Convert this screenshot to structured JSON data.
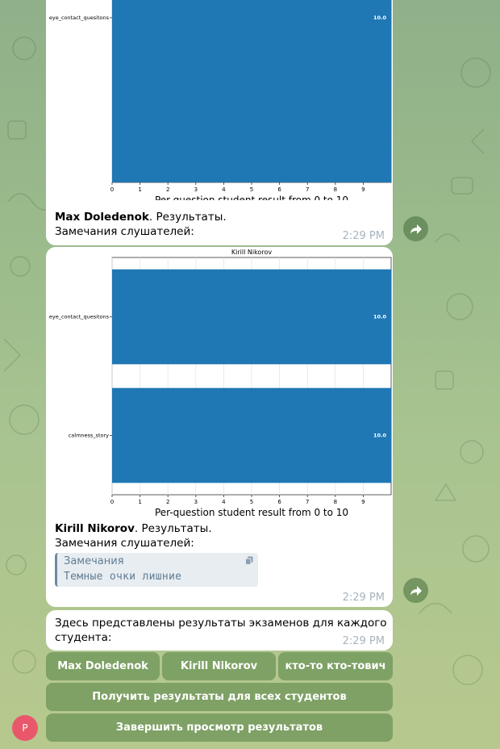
{
  "theme": {
    "accent": "#1f77b4",
    "time_color": "#a7b4be",
    "button_bg": "#70965a"
  },
  "messages": [
    {
      "chart_title": "",
      "caption_name": "Max Doledenok",
      "caption_rest": ". Результаты.",
      "remarks_label": "Замечания слушателей:",
      "time": "2:29 PM"
    },
    {
      "chart_title": "Kirill Nikorov",
      "caption_name": "Kirill Nikorov",
      "caption_rest": ". Результаты.",
      "remarks_label": "Замечания слушателей:",
      "quote_title": "Замечания",
      "quote_text": "Темные очки лишние",
      "time": "2:29 PM"
    },
    {
      "text_line1": "Здесь представлены результаты экзаменов для каждого",
      "text_line2": "студента:",
      "time": "2:29 PM"
    }
  ],
  "keyboard": {
    "row1": [
      "Max Doledenok",
      "Kirill Nikorov",
      "кто-то кто-тович"
    ],
    "all_results": "Получить результаты для всех студентов",
    "finish": "Завершить просмотр результатов"
  },
  "avatar_letter": "P",
  "chart_data": [
    {
      "type": "bar",
      "orientation": "horizontal",
      "title": "",
      "categories": [
        "eye_contact_quesitons"
      ],
      "values": [
        10.0
      ],
      "value_labels": [
        "10.0"
      ],
      "xlabel": "Per-question student result from 0 to 10",
      "xlim": [
        0,
        10
      ],
      "xticks": [
        "0",
        "1",
        "2",
        "3",
        "4",
        "5",
        "6",
        "7",
        "8",
        "9"
      ],
      "grid": true
    },
    {
      "type": "bar",
      "orientation": "horizontal",
      "title": "Kirill Nikorov",
      "categories": [
        "eye_contact_quesitons",
        "calmness_story"
      ],
      "values": [
        10.0,
        10.0
      ],
      "value_labels": [
        "10.0",
        "10.0"
      ],
      "xlabel": "Per-question student result from 0 to 10",
      "xlim": [
        0,
        10
      ],
      "xticks": [
        "0",
        "1",
        "2",
        "3",
        "4",
        "5",
        "6",
        "7",
        "8",
        "9"
      ],
      "grid": true
    }
  ]
}
